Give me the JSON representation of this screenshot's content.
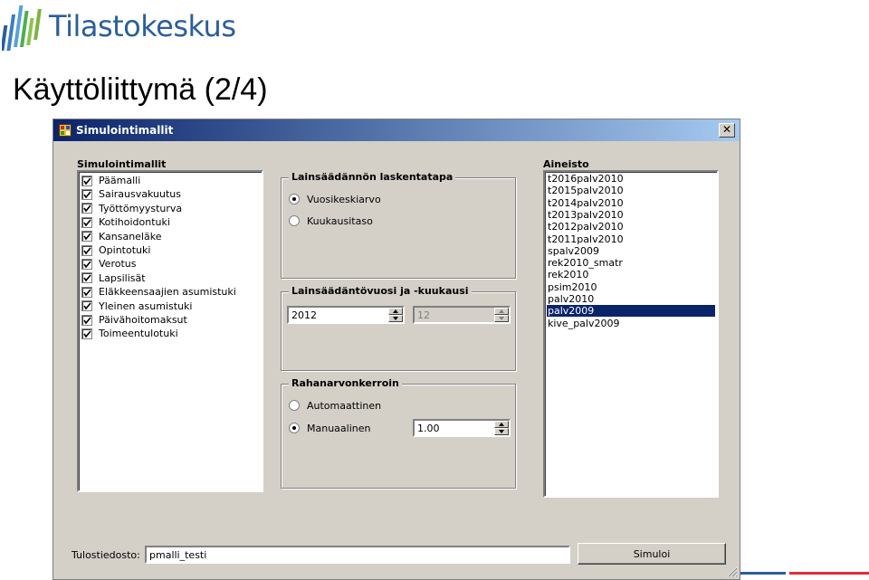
{
  "brand": {
    "name": "Tilastokeskus",
    "color": "#2c5e9a",
    "accent_red": "#e52d3a"
  },
  "slide": {
    "title": "Käyttöliittymä (2/4)"
  },
  "window": {
    "title": "Simulointimallit",
    "close_label": "✕"
  },
  "models": {
    "label": "Simulointimallit",
    "items": [
      {
        "label": "Päämalli",
        "checked": true
      },
      {
        "label": "Sairausvakuutus",
        "checked": true
      },
      {
        "label": "Työttömyysturva",
        "checked": true
      },
      {
        "label": "Kotihoidontuki",
        "checked": true
      },
      {
        "label": "Kansaneläke",
        "checked": true
      },
      {
        "label": "Opintotuki",
        "checked": true
      },
      {
        "label": "Verotus",
        "checked": true
      },
      {
        "label": "Lapsilisät",
        "checked": true
      },
      {
        "label": "Eläkkeensaajien asumistuki",
        "checked": true
      },
      {
        "label": "Yleinen asumistuki",
        "checked": true
      },
      {
        "label": "Päivähoitomaksut",
        "checked": true
      },
      {
        "label": "Toimeentulotuki",
        "checked": true
      }
    ]
  },
  "calc_method": {
    "label": "Lainsäädännön laskentatapa",
    "options": [
      {
        "label": "Vuosikeskiarvo",
        "selected": true
      },
      {
        "label": "Kuukausitaso",
        "selected": false
      }
    ]
  },
  "law_year": {
    "label": "Lainsäädäntövuosi ja -kuukausi",
    "year": "2012",
    "month": "12"
  },
  "money_coef": {
    "label": "Rahanarvonkerroin",
    "options": [
      {
        "label": "Automaattinen",
        "selected": false
      },
      {
        "label": "Manuaalinen",
        "selected": true
      }
    ],
    "value": "1.00"
  },
  "dataset": {
    "label": "Aineisto",
    "items": [
      "t2016palv2010",
      "t2015palv2010",
      "t2014palv2010",
      "t2013palv2010",
      "t2012palv2010",
      "t2011palv2010",
      "spalv2009",
      "rek2010_smatr",
      "rek2010",
      "psim2010",
      "palv2010",
      "palv2009",
      "kive_palv2009"
    ],
    "selected_index": 11
  },
  "output": {
    "label": "Tulostiedosto:",
    "value": "pmalli_testi",
    "button_label": "Simuloi"
  }
}
